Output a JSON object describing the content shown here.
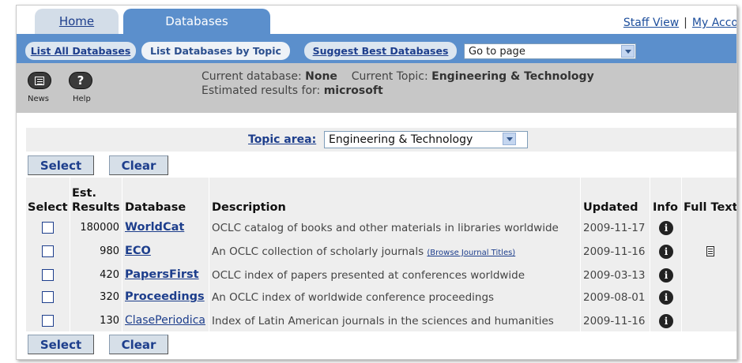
{
  "tabs": {
    "home": "Home",
    "databases": "Databases"
  },
  "top_links": {
    "staff_view": "Staff View",
    "separator": "|",
    "my_account": "My Acco"
  },
  "subnav": {
    "list_all": "List All Databases",
    "list_by_topic": "List Databases by Topic",
    "suggest": "Suggest Best Databases",
    "goto_value": "Go to page"
  },
  "infobar": {
    "news_label": "News",
    "help_label": "Help",
    "help_glyph": "?",
    "current_db_label": "Current database:",
    "current_db_value": "None",
    "current_topic_label": "Current Topic:",
    "current_topic_value": "Engineering & Technology",
    "estimated_label": "Estimated results for:",
    "estimated_value": "microsoft"
  },
  "topic": {
    "label": "Topic area:",
    "value": "Engineering & Technology"
  },
  "buttons": {
    "select": "Select",
    "clear": "Clear"
  },
  "table": {
    "headers": {
      "select": "Select",
      "est_line1": "Est.",
      "est_line2": "Results",
      "database": "Database",
      "description": "Description",
      "updated": "Updated",
      "info": "Info",
      "full_text": "Full Text"
    },
    "rows": [
      {
        "results": "180000",
        "name": "WorldCat",
        "description": "OCLC catalog of books and other materials in libraries worldwide",
        "link": "",
        "updated": "2009-11-17",
        "info": "i",
        "full_text": false
      },
      {
        "results": "980",
        "name": "ECO",
        "description": "An OCLC collection of scholarly journals",
        "link": "(Browse Journal Titles)",
        "updated": "2009-11-16",
        "info": "i",
        "full_text": true
      },
      {
        "results": "420",
        "name": "PapersFirst",
        "description": "OCLC index of papers presented at conferences worldwide",
        "link": "",
        "updated": "2009-03-13",
        "info": "i",
        "full_text": false
      },
      {
        "results": "320",
        "name": "Proceedings",
        "description": "An OCLC index of worldwide conference proceedings",
        "link": "",
        "updated": "2009-08-01",
        "info": "i",
        "full_text": false
      },
      {
        "results": "130",
        "name": "ClasePeriodica",
        "description": "Index of Latin American journals in the sciences and humanities",
        "link": "",
        "updated": "2009-11-16",
        "info": "i",
        "full_text": false
      }
    ]
  }
}
